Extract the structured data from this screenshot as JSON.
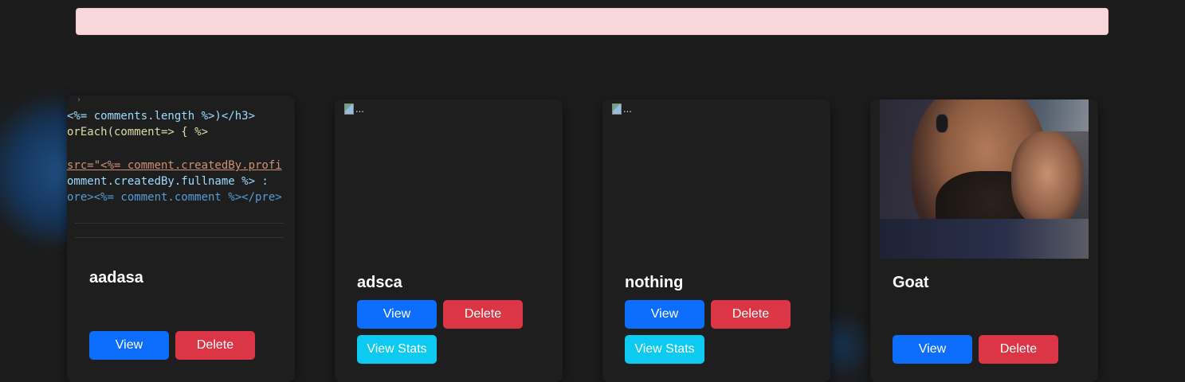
{
  "alert": {
    "text": ""
  },
  "cards": [
    {
      "title": "aadasa",
      "image": "code-screenshot",
      "code_lines": [
        "<%= comments.length %>)</h3>",
        "orEach(comment=> { %>",
        "src=\"<%= comment.createdBy.profi",
        "omment.createdBy.fullname %> :",
        "ore><%= comment.comment %></pre>"
      ],
      "buttons": {
        "view": "View",
        "delete": "Delete"
      }
    },
    {
      "title": "adsca",
      "image": "broken-image",
      "image_alt": "...",
      "buttons": {
        "view": "View",
        "delete": "Delete",
        "stats": "View Stats"
      }
    },
    {
      "title": "nothing",
      "image": "broken-image",
      "image_alt": "...",
      "buttons": {
        "view": "View",
        "delete": "Delete",
        "stats": "View Stats"
      }
    },
    {
      "title": "Goat",
      "image": "photo",
      "buttons": {
        "view": "View",
        "delete": "Delete"
      }
    }
  ],
  "colors": {
    "background": "#1c1c1c",
    "card": "#1e1e1e",
    "alert": "#f8d7da",
    "view": "#0d6efd",
    "delete": "#dc3545",
    "stats": "#0dcaf0"
  }
}
